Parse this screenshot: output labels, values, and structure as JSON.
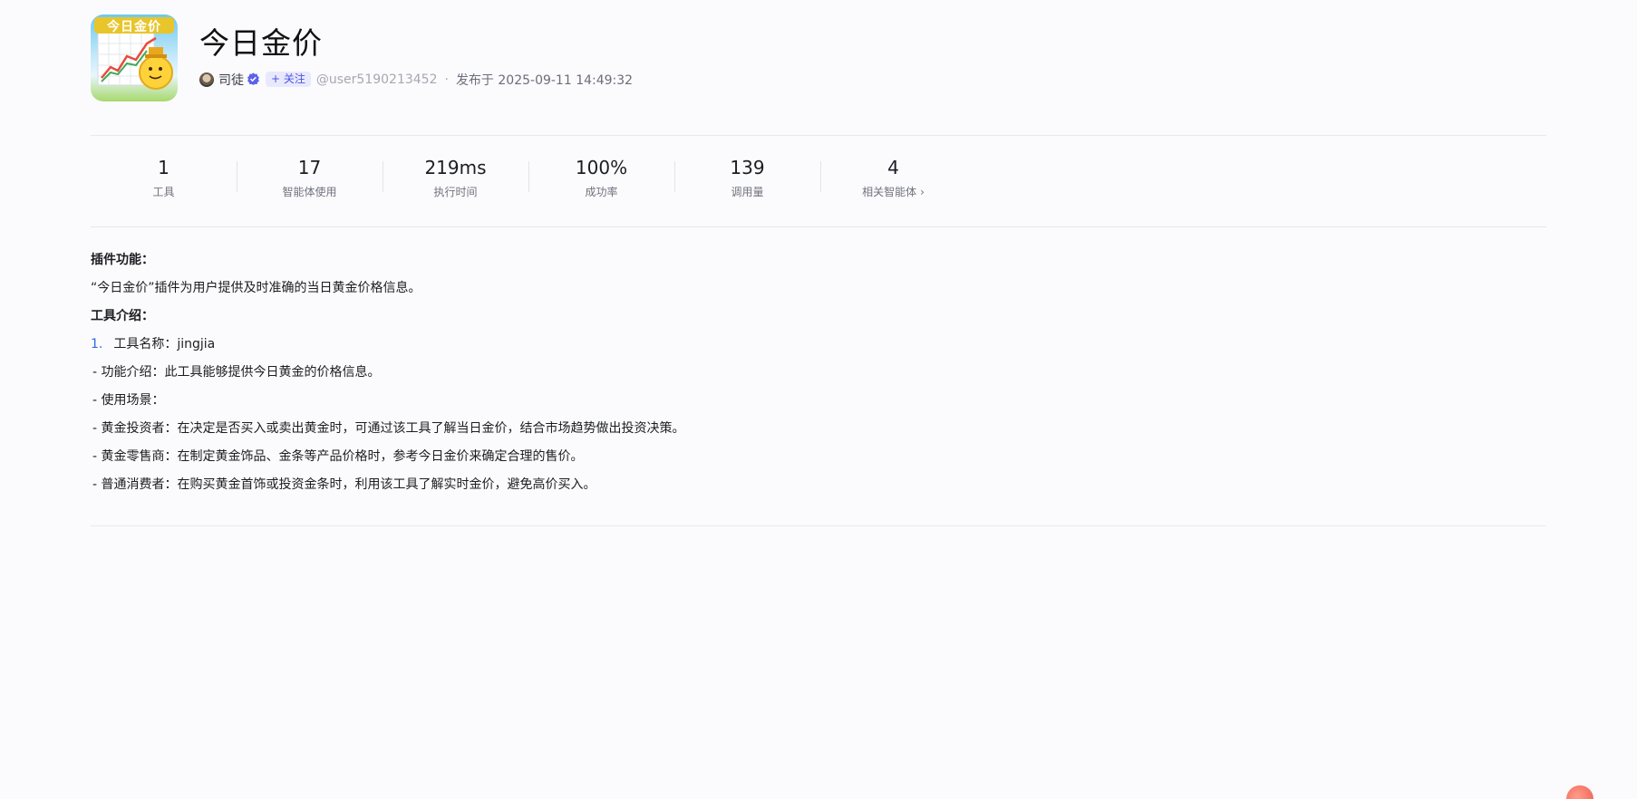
{
  "plugin": {
    "title": "今日金价",
    "logo_text": "今日金价"
  },
  "author": {
    "name": "司徒",
    "follow_label": "+ 关注",
    "handle": "@user5190213452",
    "separator": "·",
    "publish_time": "发布于 2025-09-11 14:49:32"
  },
  "stats": [
    {
      "value": "1",
      "label": "工具"
    },
    {
      "value": "17",
      "label": "智能体使用"
    },
    {
      "value": "219ms",
      "label": "执行时间"
    },
    {
      "value": "100%",
      "label": "成功率"
    },
    {
      "value": "139",
      "label": "调用量"
    },
    {
      "value": "4",
      "label": "相关智能体",
      "chevron": "›"
    }
  ],
  "description": {
    "feature_heading": "插件功能：",
    "feature_text": "“今日金价”插件为用户提供及时准确的当日黄金价格信息。",
    "tools_heading": "工具介绍：",
    "tool_number": "1.",
    "tool_name": "工具名称：jingjia",
    "lines": [
      "- 功能介绍：此工具能够提供今日黄金的价格信息。",
      "- 使用场景：",
      "- 黄金投资者：在决定是否买入或卖出黄金时，可通过该工具了解当日金价，结合市场趋势做出投资决策。",
      "- 黄金零售商：在制定黄金饰品、金条等产品价格时，参考今日金价来确定合理的售价。",
      "- 普通消费者：在购买黄金首饰或投资金条时，利用该工具了解实时金价，避免高价买入。"
    ]
  },
  "colors": {
    "accent": "#4d53e8",
    "link_number": "#2f6bd9",
    "divider": "#e8e9ed"
  }
}
